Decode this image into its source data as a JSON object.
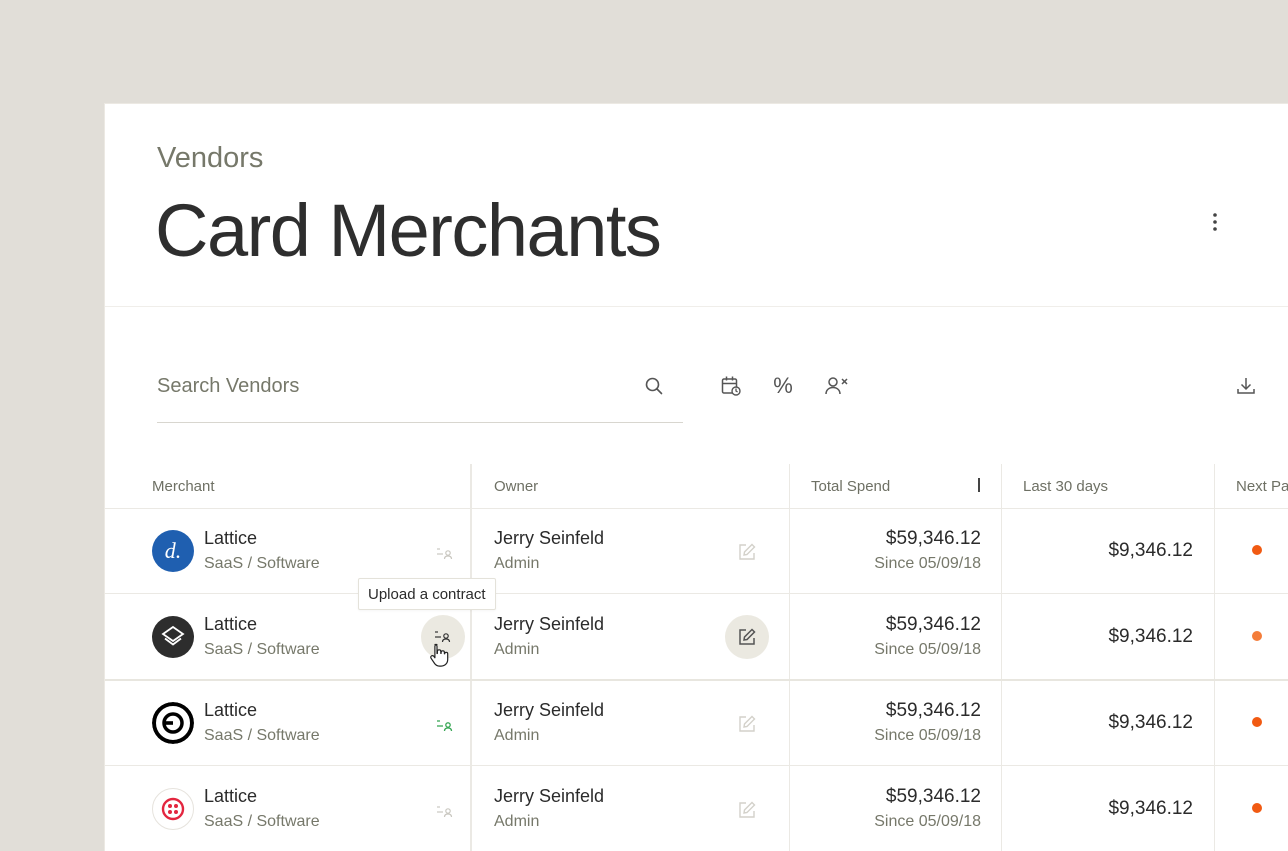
{
  "header": {
    "breadcrumb": "Vendors",
    "title": "Card Merchants"
  },
  "search": {
    "placeholder": "Search Vendors"
  },
  "toolbar": {
    "icons": [
      "calendar-refresh-icon",
      "percent-icon",
      "user-remove-icon",
      "download-icon"
    ],
    "percent_glyph": "%"
  },
  "table": {
    "columns": [
      "Merchant",
      "Owner",
      "Total Spend",
      "Last 30 days",
      "Next Pa"
    ],
    "rows": [
      {
        "logo": "d.",
        "logo_color": "#1f5fb0",
        "merchant": "Lattice",
        "category": "SaaS / Software",
        "owner": "Jerry Seinfeld",
        "role": "Admin",
        "total_spend": "$59,346.12",
        "since": "Since 05/09/18",
        "last_30": "$9,346.12",
        "status_color": "#f15a12"
      },
      {
        "logo": "layers",
        "logo_color": "#2d2d2d",
        "merchant": "Lattice",
        "category": "SaaS / Software",
        "owner": "Jerry Seinfeld",
        "role": "Admin",
        "total_spend": "$59,346.12",
        "since": "Since 05/09/18",
        "last_30": "$9,346.12",
        "status_color": "#f47d3a"
      },
      {
        "logo": "uber",
        "logo_color": "#000000",
        "merchant": "Lattice",
        "category": "SaaS / Software",
        "owner": "Jerry Seinfeld",
        "role": "Admin",
        "total_spend": "$59,346.12",
        "since": "Since 05/09/18",
        "last_30": "$9,346.12",
        "status_color": "#f15a12"
      },
      {
        "logo": "twilio",
        "logo_color": "#e3263f",
        "merchant": "Lattice",
        "category": "SaaS / Software",
        "owner": "Jerry Seinfeld",
        "role": "Admin",
        "total_spend": "$59,346.12",
        "since": "Since 05/09/18",
        "last_30": "$9,346.12",
        "status_color": "#f15a12"
      }
    ]
  },
  "tooltip": {
    "text": "Upload a contract"
  },
  "colors": {
    "accent_green": "#3aa857",
    "status_orange": "#f15a12"
  }
}
